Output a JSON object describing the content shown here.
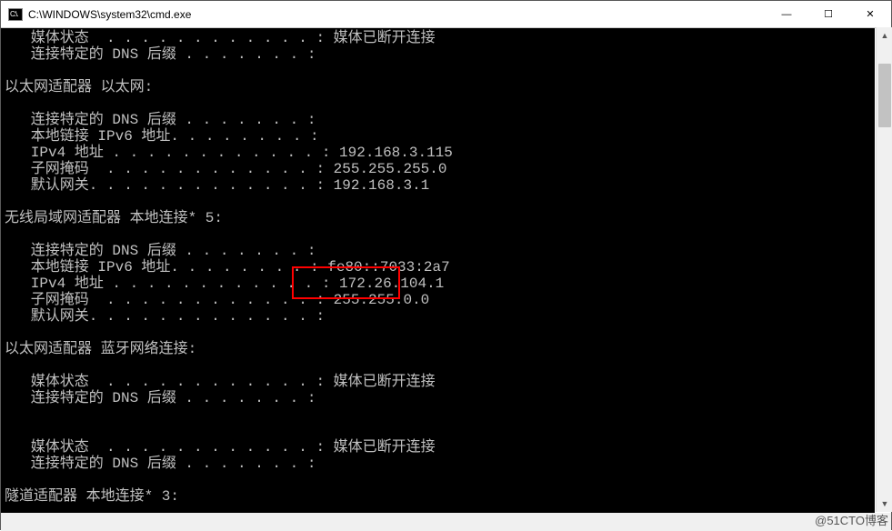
{
  "window": {
    "title": "C:\\WINDOWS\\system32\\cmd.exe",
    "icon_label": "C:\\."
  },
  "buttons": {
    "min_glyph": "—",
    "max_glyph": "☐",
    "close_glyph": "✕"
  },
  "highlight": {
    "value": "172.26.104.1"
  },
  "terminal_lines": [
    "   媒体状态  . . . . . . . . . . . . : 媒体已断开连接",
    "   连接特定的 DNS 后缀 . . . . . . . :",
    "",
    "以太网适配器 以太网:",
    "",
    "   连接特定的 DNS 后缀 . . . . . . . :",
    "   本地链接 IPv6 地址. . . . . . . . :",
    "   IPv4 地址 . . . . . . . . . . . . : 192.168.3.115",
    "   子网掩码  . . . . . . . . . . . . : 255.255.255.0",
    "   默认网关. . . . . . . . . . . . . : 192.168.3.1",
    "",
    "无线局域网适配器 本地连接* 5:",
    "",
    "   连接特定的 DNS 后缀 . . . . . . . :",
    "   本地链接 IPv6 地址. . . . . . . . : fe80::7033:2a7",
    "   IPv4 地址 . . . . . . . . . . . . : 172.26.104.1",
    "   子网掩码  . . . . . . . . . . . . : 255.255.0.0",
    "   默认网关. . . . . . . . . . . . . :",
    "",
    "以太网适配器 蓝牙网络连接:",
    "",
    "   媒体状态  . . . . . . . . . . . . : 媒体已断开连接",
    "   连接特定的 DNS 后缀 . . . . . . . :",
    "",
    "",
    "   媒体状态  . . . . . . . . . . . . : 媒体已断开连接",
    "   连接特定的 DNS 后缀 . . . . . . . :",
    "",
    "隧道适配器 本地连接* 3:"
  ],
  "watermark": "@51CTO博客"
}
